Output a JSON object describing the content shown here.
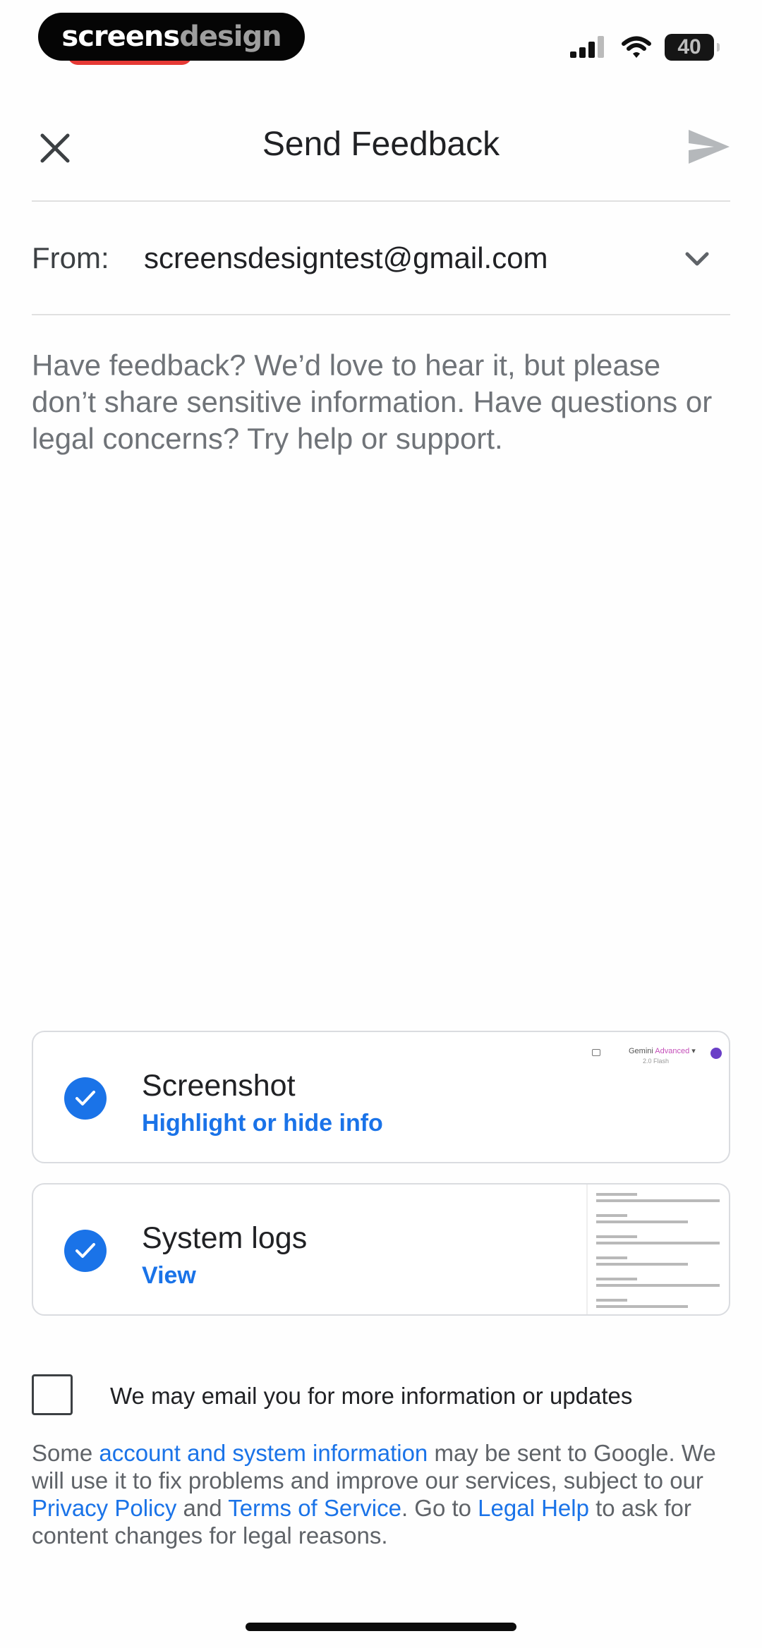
{
  "brand": {
    "part1": "screens",
    "part2": "design"
  },
  "status_bar": {
    "battery": "40"
  },
  "header": {
    "title": "Send Feedback"
  },
  "from": {
    "label": "From:",
    "email": "screensdesigntest@gmail.com"
  },
  "feedback": {
    "placeholder": "Have feedback? We’d love to hear it, but please don’t share sensitive information. Have questions or legal concerns? Try help or support."
  },
  "attachments": [
    {
      "title": "Screenshot",
      "link": "Highlight or hide info",
      "checked": true,
      "thumb": {
        "app": "Gemini",
        "app_accent": "Advanced",
        "model": "2.0 Flash",
        "badge": "S"
      }
    },
    {
      "title": "System logs",
      "link": "View",
      "checked": true
    }
  ],
  "email_optin": {
    "label": "We may email you for more information or updates",
    "checked": false
  },
  "legal": {
    "t1": "Some ",
    "link1": "account and system information",
    "t2": " may be sent to Google. We will use it to fix problems and improve our services, subject to our ",
    "link2": "Privacy Policy",
    "t3": " and ",
    "link3": "Terms of Service",
    "t4": ". Go to ",
    "link4": "Legal Help",
    "t5": " to ask for content changes for legal reasons."
  },
  "colors": {
    "accent": "#1a73e8",
    "text_primary": "#202124",
    "text_secondary": "#5f6368"
  }
}
